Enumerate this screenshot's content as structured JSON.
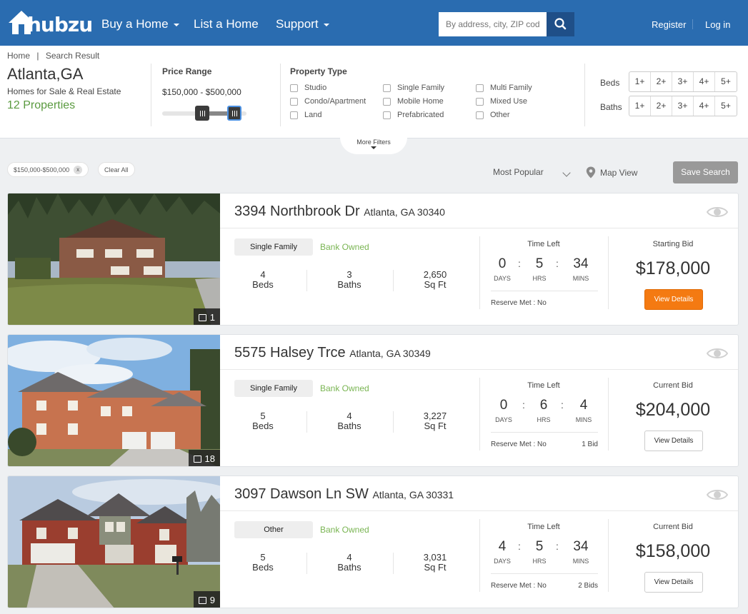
{
  "nav": {
    "logo": "hubzu",
    "logo_mark": "®",
    "items": [
      {
        "label": "Buy a Home",
        "dropdown": true
      },
      {
        "label": "List a Home",
        "dropdown": false
      },
      {
        "label": "Support",
        "dropdown": true
      }
    ],
    "search_placeholder": "By address, city, ZIP code",
    "register": "Register",
    "login": "Log in"
  },
  "breadcrumb": {
    "home": "Home",
    "sep": "|",
    "current": "Search Result"
  },
  "location": {
    "city": "Atlanta,GA",
    "subtitle": "Homes for Sale & Real Estate",
    "count": "12 Properties"
  },
  "filters": {
    "price_label": "Price Range",
    "price_value": "$150,000 - $500,000",
    "price_min_fraction": 0.47,
    "price_max_fraction": 0.85,
    "property_type_label": "Property Type",
    "property_types": [
      "Studio",
      "Condo/Apartment",
      "Land",
      "Single Family",
      "Mobile Home",
      "Prefabricated",
      "Multi Family",
      "Mixed Use",
      "Other"
    ],
    "beds_label": "Beds",
    "baths_label": "Baths",
    "room_options": [
      "1+",
      "2+",
      "3+",
      "4+",
      "5+"
    ],
    "more_filters": "More Filters"
  },
  "toolbar": {
    "chip_price": "$150,000-$500,000",
    "chip_remove": "x",
    "clear_all": "Clear All",
    "sort": "Most Popular",
    "map_view": "Map View",
    "save_search": "Save Search"
  },
  "labels": {
    "beds": "Beds",
    "baths": "Baths",
    "sqft": "Sq Ft",
    "time_left": "Time Left",
    "days": "DAYS",
    "hrs": "HRS",
    "mins": "MINS",
    "colon": ":",
    "view_details": "View Details"
  },
  "listings": [
    {
      "street": "3394 Northbrook Dr",
      "city": "Atlanta, GA 30340",
      "photo_count": "1",
      "type": "Single Family",
      "status": "Bank Owned",
      "beds": "4",
      "baths": "3",
      "sqft": "2,650",
      "days": "0",
      "hrs": "5",
      "mins": "34",
      "reserve": "Reserve Met : No",
      "bids": "",
      "bid_label": "Starting Bid",
      "bid_amount": "$178,000"
    },
    {
      "street": "5575 Halsey Trce",
      "city": "Atlanta, GA 30349",
      "photo_count": "18",
      "type": "Single Family",
      "status": "Bank Owned",
      "beds": "5",
      "baths": "4",
      "sqft": "3,227",
      "days": "0",
      "hrs": "6",
      "mins": "4",
      "reserve": "Reserve Met : No",
      "bids": "1 Bid",
      "bid_label": "Current Bid",
      "bid_amount": "$204,000"
    },
    {
      "street": "3097 Dawson Ln SW",
      "city": "Atlanta, GA 30331",
      "photo_count": "9",
      "type": "Other",
      "status": "Bank Owned",
      "beds": "5",
      "baths": "4",
      "sqft": "3,031",
      "days": "4",
      "hrs": "5",
      "mins": "34",
      "reserve": "Reserve Met : No",
      "bids": "2 Bids",
      "bid_label": "Current Bid",
      "bid_amount": "$158,000"
    }
  ],
  "colors": {
    "header_blue": "#2a6cb0",
    "search_button": "#1f4f88",
    "accent_green": "#5a9a3f",
    "orange_button": "#f47a12",
    "save_gray": "#999999"
  }
}
